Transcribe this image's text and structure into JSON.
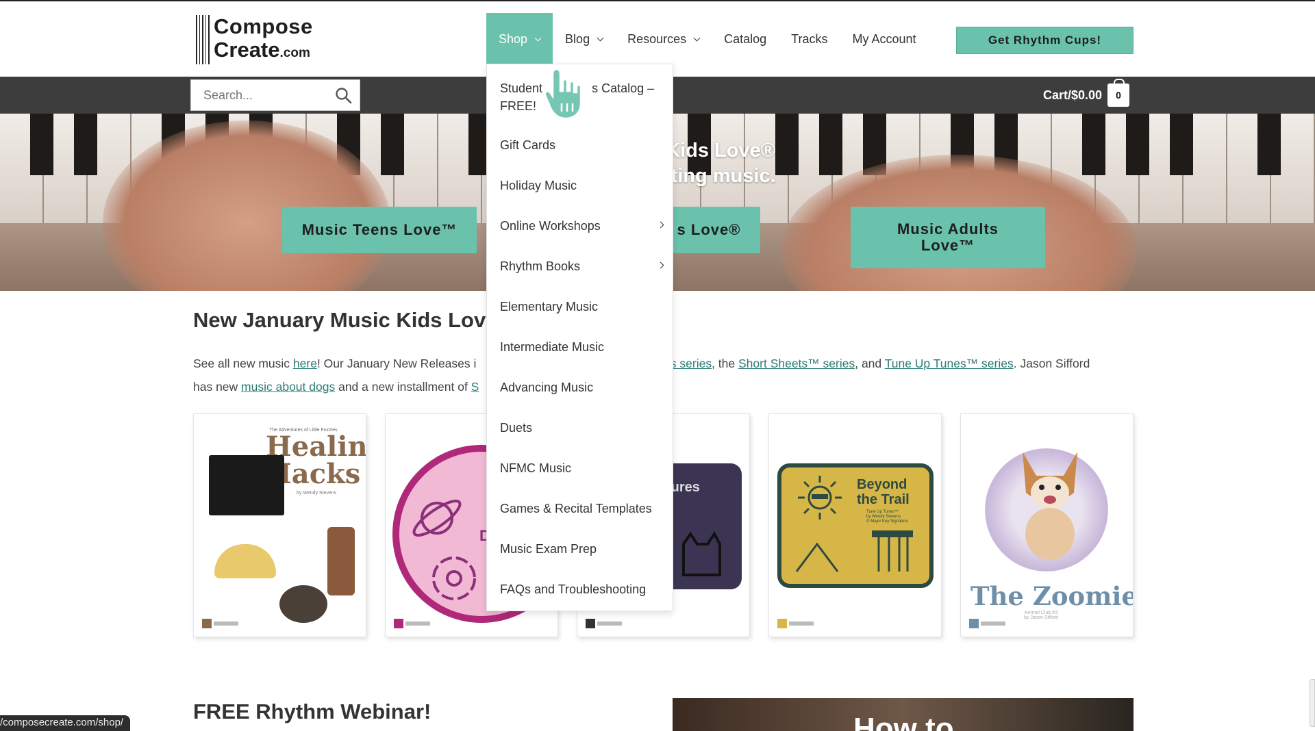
{
  "logo": {
    "line1": "Compose",
    "line2": "Create",
    "suffix": ".com"
  },
  "nav": {
    "items": [
      {
        "label": "Shop",
        "has_dropdown": true,
        "active": true
      },
      {
        "label": "Blog",
        "has_dropdown": true
      },
      {
        "label": "Resources",
        "has_dropdown": true
      },
      {
        "label": "Catalog"
      },
      {
        "label": "Tracks"
      },
      {
        "label": "My Account"
      }
    ],
    "cta_label": "Get Rhythm Cups!"
  },
  "search": {
    "placeholder": "Search..."
  },
  "cart": {
    "label": "Cart/$0.00",
    "count": "0"
  },
  "hero": {
    "heading_line1": "c Kids Love®",
    "heading_line2": "eating music.",
    "buttons": {
      "teens": "Music Teens Love™",
      "kids": "s Love®",
      "adults": "Music Adults Love™"
    }
  },
  "shop_menu": {
    "items": [
      {
        "label": "Student",
        "label2": "s Catalog –",
        "label3": "FREE!"
      },
      {
        "label": "Gift Cards"
      },
      {
        "label": "Holiday Music"
      },
      {
        "label": "Online Workshops",
        "submenu": true
      },
      {
        "label": "Rhythm Books",
        "submenu": true
      },
      {
        "label": "Elementary Music"
      },
      {
        "label": "Intermediate Music"
      },
      {
        "label": "Advancing Music"
      },
      {
        "label": "Duets"
      },
      {
        "label": "NFMC Music"
      },
      {
        "label": "Games & Recital Templates"
      },
      {
        "label": "Music Exam Prep"
      },
      {
        "label": "FAQs and Troubleshooting"
      }
    ]
  },
  "section1": {
    "title": "New January Music Kids Lov",
    "p_see": "See all new music ",
    "link_here": "here",
    "p_releases": "! Our January New Releases i",
    "link_zies": "zies series",
    "p_the": ", the ",
    "link_short": "Short Sheets™ series",
    "p_and": ", and ",
    "link_tune": "Tune Up Tunes™ series",
    "p_jason": ". Jason Sifford",
    "p_has": "has new ",
    "link_dogs": "music about dogs",
    "p_install": " and a new installment of ",
    "link_s": "S"
  },
  "products": [
    {
      "small": "The Adventures of Little Fuzzies",
      "title1": "Healing",
      "title2": "Hacks",
      "by": "by Wendy Stevens"
    },
    {
      "title": "D"
    },
    {
      "title": "tures"
    },
    {
      "title1": "Beyond",
      "title2": "the Trail",
      "sub1": "Tune Up Tunes™",
      "sub2": "by Wendy Stevens",
      "sub3": "G Major Key Signature"
    },
    {
      "title": "The Zoomies!",
      "sub1": "Kennel Club #3",
      "sub2": "by Jason Sifford"
    }
  ],
  "section2": {
    "title": "FREE Rhythm Webinar!"
  },
  "video": {
    "title": "How to"
  },
  "status_url": "/composecreate.com/shop/",
  "colors": {
    "accent": "#6ac2ad",
    "dark_bar": "#3d3d3d",
    "link": "#2b7c74"
  }
}
